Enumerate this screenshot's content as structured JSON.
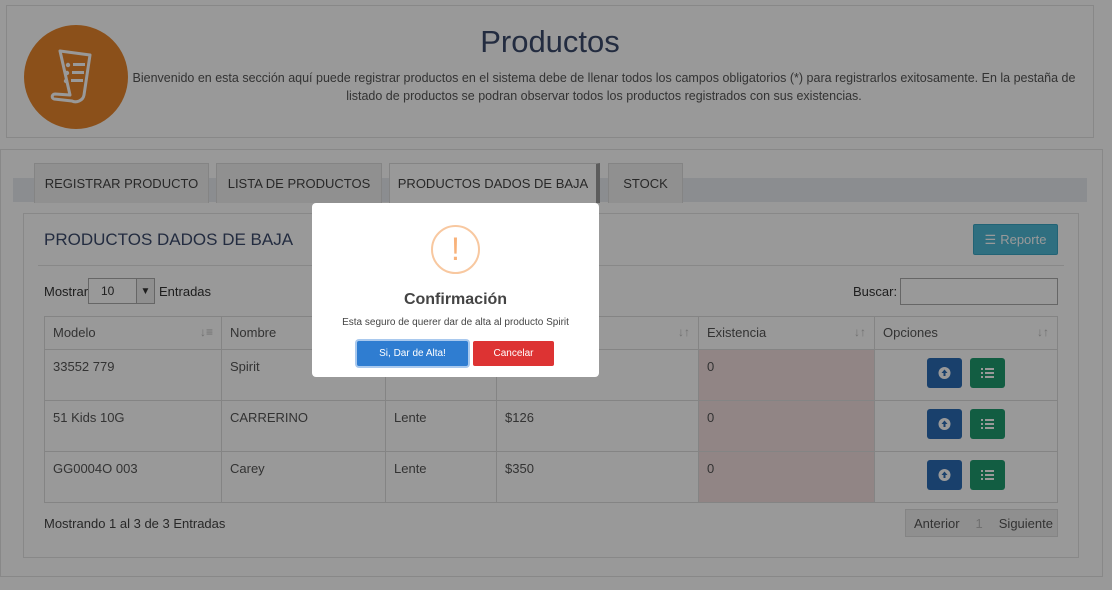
{
  "header": {
    "title": "Productos",
    "description": "Bienvenido en esta sección aquí puede registrar productos en el sistema debe de llenar todos los campos obligatorios (*) para registrarlos exitosamente. En la pestaña de listado de productos se podran observar todos los productos registrados con sus existencias."
  },
  "tabs": [
    {
      "label": "REGISTRAR PRODUCTO"
    },
    {
      "label": "LISTA DE PRODUCTOS"
    },
    {
      "label": "PRODUCTOS DADOS DE BAJA"
    },
    {
      "label": "STOCK"
    }
  ],
  "panel": {
    "title": "PRODUCTOS DADOS DE BAJA",
    "report_label": "Reporte",
    "show_label": "Mostrar",
    "show_value": "10",
    "entries_label": "Entradas",
    "search_label": "Buscar:"
  },
  "table": {
    "headers": [
      "Modelo",
      "Nombre",
      "",
      "",
      "Existencia",
      "Opciones"
    ],
    "rows": [
      {
        "modelo": "33552 779",
        "nombre": "Spirit",
        "tipo": "",
        "precio": "",
        "existencia": "0"
      },
      {
        "modelo": "51 Kids 10G",
        "nombre": "CARRERINO",
        "tipo": "Lente",
        "precio": "$126",
        "existencia": "0"
      },
      {
        "modelo": "GG0004O 003",
        "nombre": "Carey",
        "tipo": "Lente",
        "precio": "$350",
        "existencia": "0"
      }
    ]
  },
  "footer": {
    "info": "Mostrando 1 al 3 de 3 Entradas",
    "prev": "Anterior",
    "page": "1",
    "next": "Siguiente"
  },
  "modal": {
    "icon": "!",
    "title": "Confirmación",
    "message": "Esta seguro de querer dar de alta al producto Spirit",
    "confirm": "Si, Dar de Alta!",
    "cancel": "Cancelar"
  }
}
